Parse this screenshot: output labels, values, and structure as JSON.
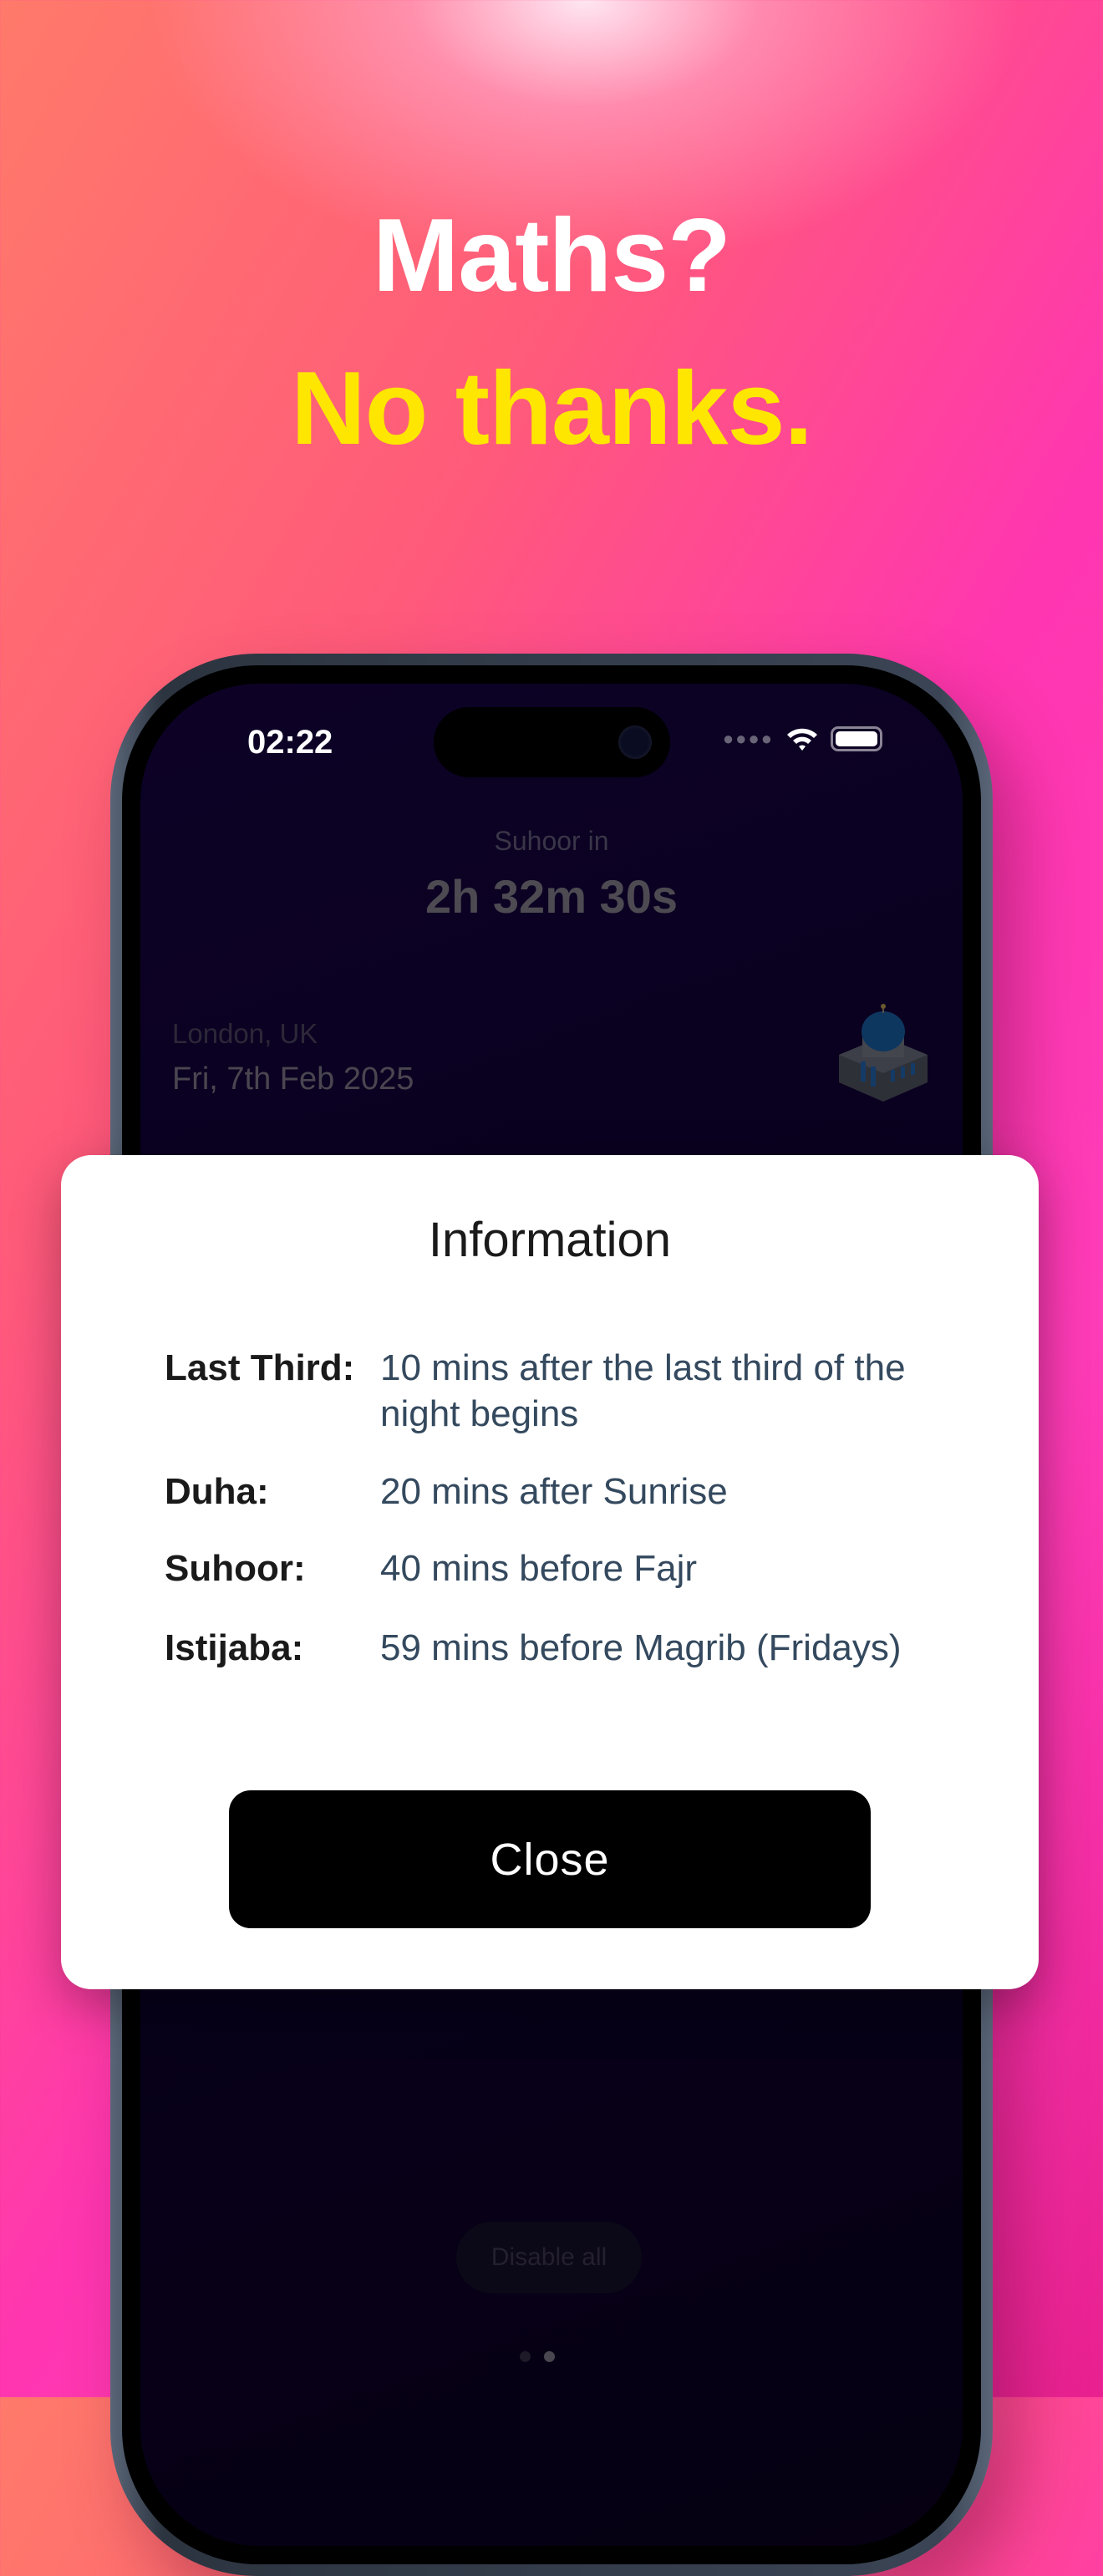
{
  "headline": {
    "line1": "Maths?",
    "line2": "No thanks."
  },
  "status_bar": {
    "time": "02:22"
  },
  "app": {
    "countdown_label": "Suhoor in",
    "countdown": "2h 32m 30s",
    "location": "London, UK",
    "date": "Fri, 7th Feb 2025",
    "disable_all": "Disable all"
  },
  "modal": {
    "title": "Information",
    "rows": [
      {
        "label": "Last Third:",
        "value": "10 mins after the last third of the night begins"
      },
      {
        "label": "Duha:",
        "value": "20 mins after Sunrise"
      },
      {
        "label": "Suhoor:",
        "value": "40 mins before Fajr"
      },
      {
        "label": "Istijaba:",
        "value": "59 mins before Magrib (Fridays)"
      }
    ],
    "close": "Close"
  },
  "pager": {
    "count": 2,
    "active": 2
  }
}
